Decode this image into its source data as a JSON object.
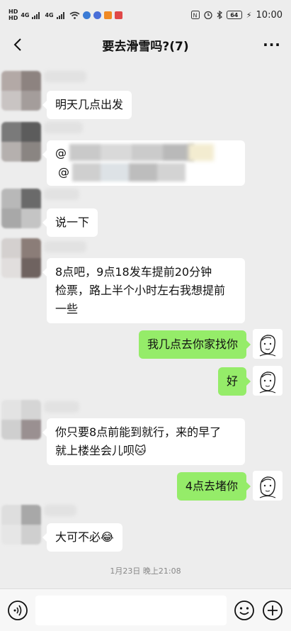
{
  "status_bar": {
    "left_labels": [
      "HD",
      "HD",
      "4G",
      "4G"
    ],
    "battery": "64",
    "time": "10:00"
  },
  "nav": {
    "title": "要去滑雪吗?(7)",
    "more": "···"
  },
  "messages": [
    {
      "side": "left",
      "text": "明天几点出发"
    },
    {
      "side": "left",
      "text": "@",
      "mention_second": "@"
    },
    {
      "side": "left",
      "text": "说一下"
    },
    {
      "side": "left",
      "lines": [
        "8点吧，9点18发车提前20分钟",
        "检票，路上半个小时左右我想提前",
        "一些"
      ]
    },
    {
      "side": "right",
      "text": "我几点去你家找你"
    },
    {
      "side": "right",
      "text": "好"
    },
    {
      "side": "left",
      "lines": [
        "你只要8点前能到就行，来的早了",
        "就上楼坐会儿呗"
      ],
      "emoji": "🐱"
    },
    {
      "side": "right",
      "text": "4点去堵你"
    },
    {
      "side": "left",
      "text": "大可不必",
      "emoji": "😂"
    }
  ],
  "timestamp": "1月23日 晚上21:08",
  "input": {
    "placeholder": ""
  }
}
